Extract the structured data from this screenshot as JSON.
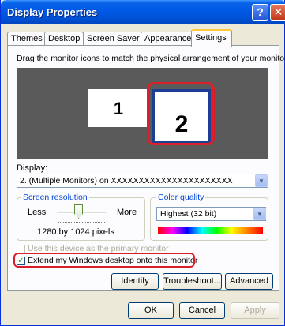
{
  "window": {
    "title": "Display Properties",
    "help_glyph": "?",
    "close_glyph": "✕"
  },
  "tabs": [
    {
      "label": "Themes"
    },
    {
      "label": "Desktop"
    },
    {
      "label": "Screen Saver"
    },
    {
      "label": "Appearance"
    },
    {
      "label": "Settings",
      "active": true
    }
  ],
  "settings": {
    "instruction": "Drag the monitor icons to match the physical arrangement of your monitors.",
    "monitors": [
      {
        "label": "1"
      },
      {
        "label": "2",
        "selected": true
      }
    ],
    "display_label": "Display:",
    "display_value": "2. (Multiple Monitors) on  XXXXXXXXXXXXXXXXXXXXXX",
    "resolution": {
      "title": "Screen resolution",
      "less": "Less",
      "more": "More",
      "value_text": "1280 by 1024 pixels"
    },
    "color_quality": {
      "title": "Color quality",
      "selected": "Highest (32 bit)"
    },
    "primary_checkbox": {
      "label": "Use this device as the primary monitor",
      "checked": false,
      "enabled": false
    },
    "extend_checkbox": {
      "label": "Extend my Windows desktop onto this monitor",
      "checked": true,
      "enabled": true
    },
    "buttons": {
      "identify": "Identify",
      "troubleshoot": "Troubleshoot...",
      "advanced": "Advanced"
    }
  },
  "dialog_buttons": {
    "ok": "OK",
    "cancel": "Cancel",
    "apply": "Apply"
  },
  "colors": {
    "titlebar": "#0058e6",
    "highlight": "#d9202a",
    "monitor_area": "#5a5a5a",
    "group_title": "#0046d5"
  },
  "icons": {
    "dropdown": "chevron-down-icon",
    "checkmark": "checkmark-icon"
  }
}
